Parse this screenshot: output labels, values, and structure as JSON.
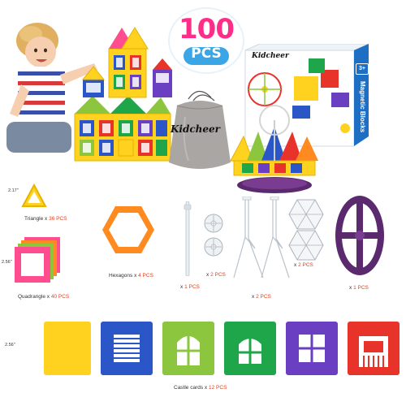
{
  "brand": {
    "name": "Kidcheer"
  },
  "badge": {
    "count": "100",
    "unit": "PCS"
  },
  "box": {
    "brand": "Kidcheer",
    "side_title": "Magnetic Blocks",
    "age": "3+"
  },
  "pieces": {
    "triangle": {
      "label": "Triangle x ",
      "qty": "36 PCS",
      "size": "2.17\""
    },
    "quadrangle": {
      "label": "Quadrangle x ",
      "qty": "40 PCS",
      "size": "2.56\""
    },
    "hexagon": {
      "label": "Hexagons x ",
      "qty": "4 PCS"
    },
    "connector_stick": {
      "label": "x ",
      "qty": "1 PCS"
    },
    "wheel_pair": {
      "label": "x ",
      "qty": "2 PCS"
    },
    "bracket": {
      "label": "x ",
      "qty": "2 PCS"
    },
    "hex_frame": {
      "label": "x ",
      "qty": "2 PCS"
    },
    "oval_base": {
      "label": "x ",
      "qty": "1 PCS"
    },
    "castle_cards": {
      "label": "Castle cards x ",
      "qty": "12 PCS",
      "size": "2.56\""
    }
  },
  "colors": {
    "badge_pink": "#ff2d8a",
    "badge_blue": "#3aa6e6",
    "qty_red": "#e6401f",
    "card_yellow": "#ffd21f",
    "card_blue": "#2a56c8",
    "card_lime": "#8cc63f",
    "card_green": "#1fa64a",
    "card_purple": "#6a3fc1",
    "card_red": "#e8332b"
  }
}
